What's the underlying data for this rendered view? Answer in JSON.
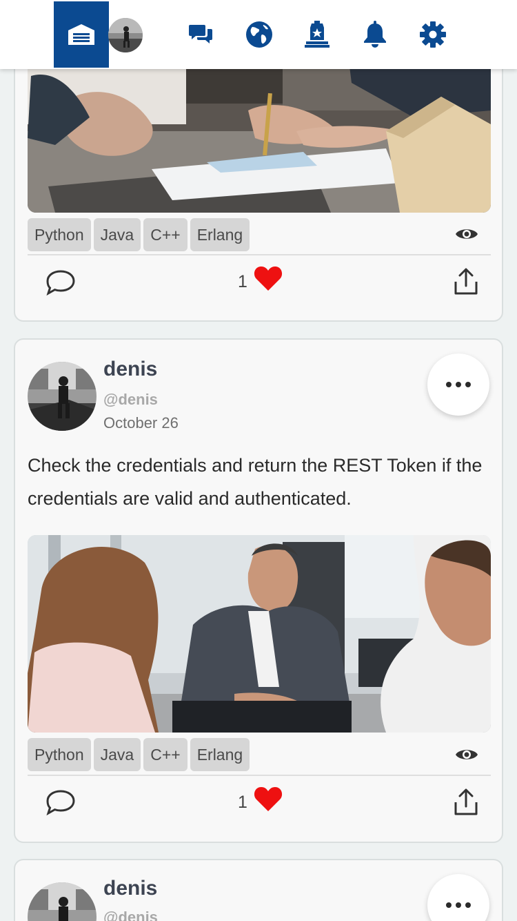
{
  "nav": {
    "home_icon": "home-icon",
    "avatar_icon": "user-avatar",
    "icons": [
      "chat-icon",
      "globe-icon",
      "police-badge-icon",
      "bell-icon",
      "gear-icon"
    ],
    "accent_color": "#0b4a91"
  },
  "posts": [
    {
      "tags": [
        "Python",
        "Java",
        "C++",
        "Erlang"
      ],
      "likes": "1"
    },
    {
      "author_name": "denis",
      "author_handle": "@denis",
      "date": "October 26",
      "text": "Check the credentials and return the REST Token if the credentials are valid and authenticated.",
      "tags": [
        "Python",
        "Java",
        "C++",
        "Erlang"
      ],
      "likes": "1"
    },
    {
      "author_name": "denis",
      "author_handle": "@denis"
    }
  ],
  "colors": {
    "heart": "#ee1111",
    "tag_bg": "#d6d6d6",
    "card_bg": "#f8f8f8"
  }
}
